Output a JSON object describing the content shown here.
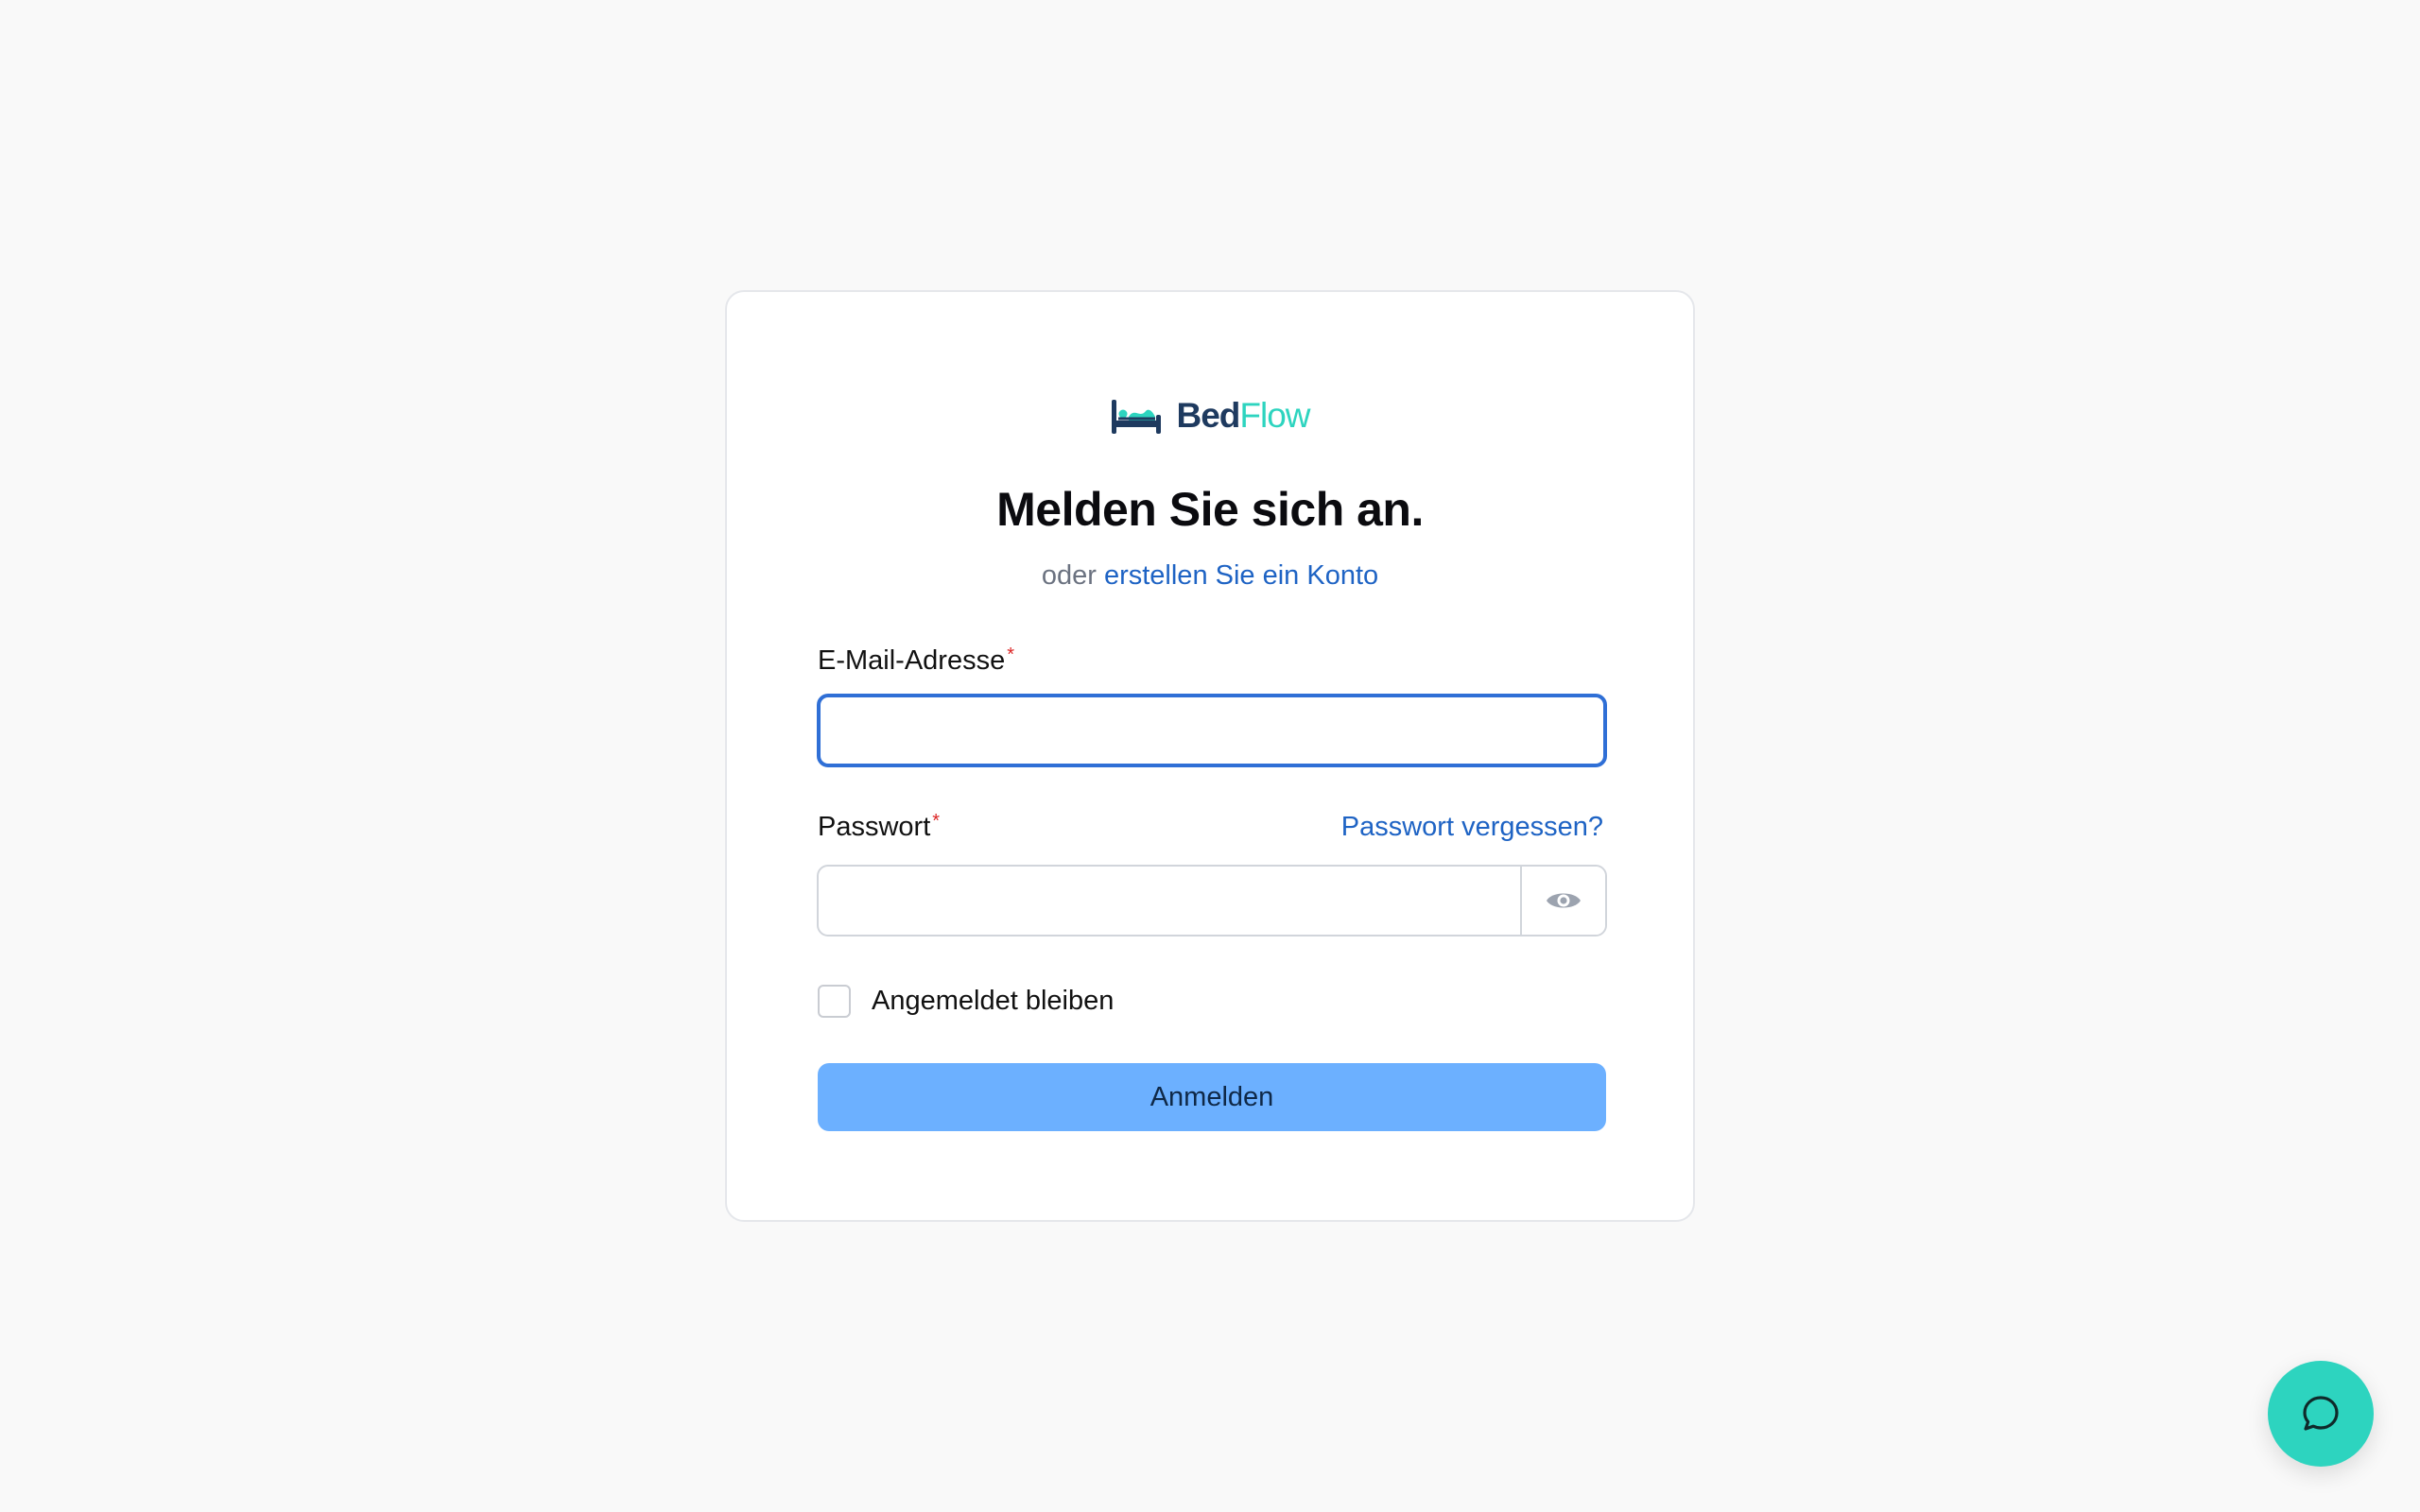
{
  "brand": {
    "part1": "Bed",
    "part2": "Flow",
    "accent": "#2dd4bf",
    "primary": "#1e3a5f"
  },
  "login": {
    "heading": "Melden Sie sich an.",
    "or_text": "oder",
    "create_account_link": "erstellen Sie ein Konto",
    "email_label": "E-Mail-Adresse",
    "email_value": "",
    "required_mark": "*",
    "password_label": "Passwort",
    "password_value": "",
    "forgot_link": "Passwort vergessen?",
    "password_toggle_icon": "eye-icon",
    "remember_label": "Angemeldet bleiben",
    "remember_checked": false,
    "submit_label": "Anmelden"
  },
  "chat": {
    "icon": "chat-bubble-icon"
  },
  "colors": {
    "link": "#1e63c4",
    "focus_border": "#2f6fd6",
    "submit_bg": "#6cb0ff",
    "required": "#dc2626",
    "page_bg": "#f9f9f9"
  }
}
